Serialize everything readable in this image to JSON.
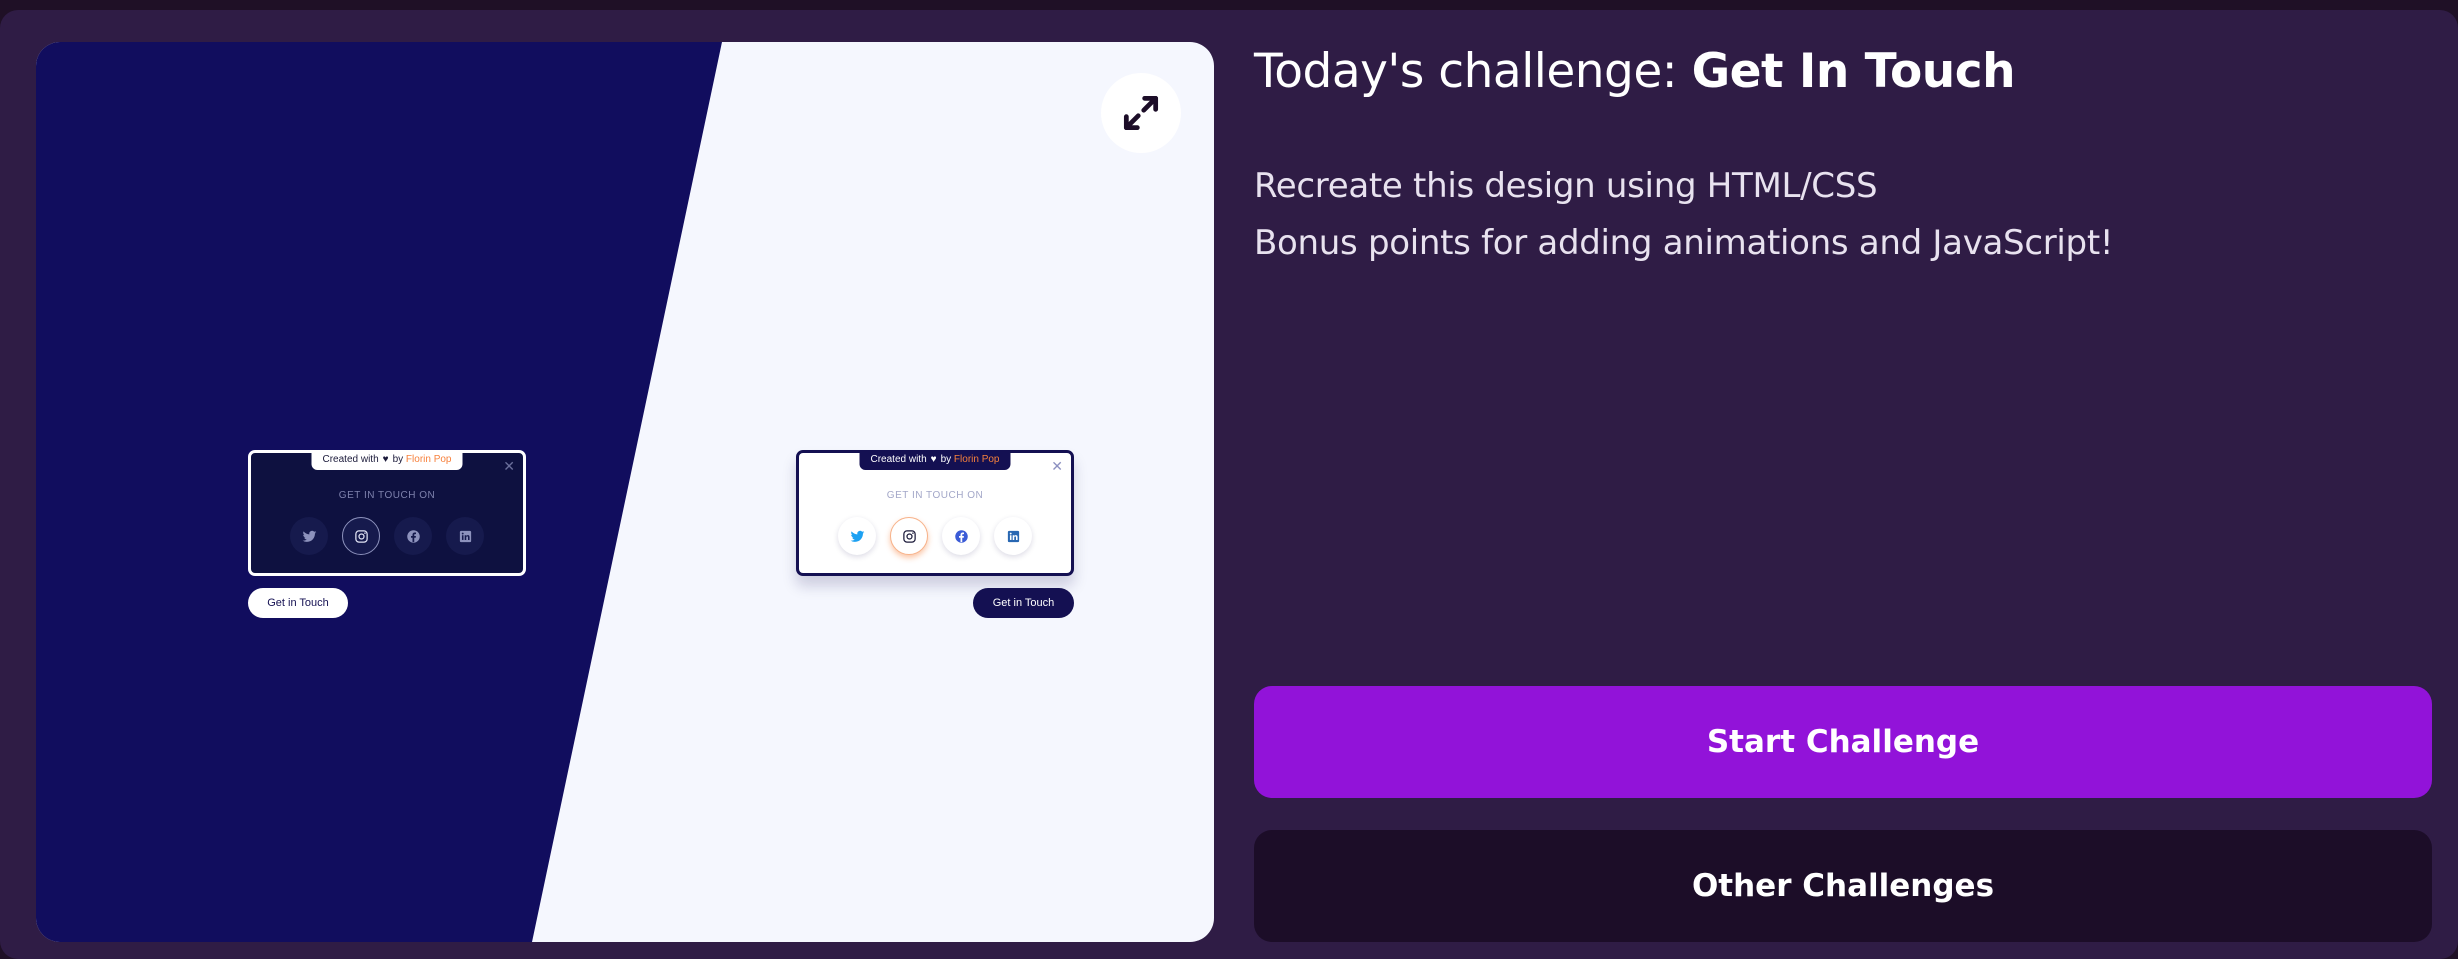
{
  "preview": {
    "expand_icon": "expand-arrows-icon",
    "dark_card": {
      "credit_prefix": "Created with",
      "credit_by": "by",
      "credit_author": "Florin Pop",
      "label": "GET IN TOUCH ON",
      "button": "Get in Touch"
    },
    "light_card": {
      "credit_prefix": "Created with",
      "credit_by": "by",
      "credit_author": "Florin Pop",
      "label": "GET IN TOUCH ON",
      "button": "Get in Touch"
    },
    "social_icons": [
      "twitter-icon",
      "instagram-icon",
      "facebook-icon",
      "linkedin-icon"
    ],
    "colors": {
      "dark_bg": "#110d5e",
      "light_bg": "#f5f7fe",
      "accent": "#f7813c"
    }
  },
  "challenge": {
    "title_prefix": "Today's challenge:",
    "title_name": "Get In Touch",
    "desc_line1": "Recreate this design using HTML/CSS",
    "desc_line2": "Bonus points for adding animations and JavaScript!"
  },
  "buttons": {
    "start": "Start Challenge",
    "other": "Other Challenges"
  },
  "colors": {
    "page_bg": "#2f1c45",
    "primary": "#9213d9",
    "secondary": "#1c0d28"
  }
}
